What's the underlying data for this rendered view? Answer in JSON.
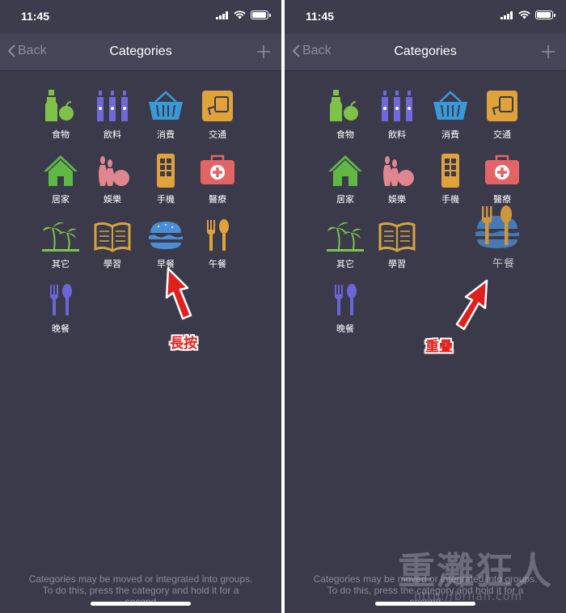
{
  "status": {
    "time": "11:45",
    "battery_level": 0.85
  },
  "navbar": {
    "back_label": "Back",
    "title": "Categories"
  },
  "categories": [
    {
      "label": "食物",
      "icon": "food-icon",
      "color": "#7fc24a"
    },
    {
      "label": "飲料",
      "icon": "drink-icon",
      "color": "#7069d9"
    },
    {
      "label": "消費",
      "icon": "basket-icon",
      "color": "#3a9ad9"
    },
    {
      "label": "交通",
      "icon": "transport-card-icon",
      "color": "#e0a23a"
    },
    {
      "label": "居家",
      "icon": "house-icon",
      "color": "#5fb843"
    },
    {
      "label": "娛樂",
      "icon": "bowling-icon",
      "color": "#e0868f"
    },
    {
      "label": "手機",
      "icon": "phone-icon",
      "color": "#e0a23a"
    },
    {
      "label": "醫療",
      "icon": "medkit-icon",
      "color": "#e46465"
    },
    {
      "label": "其它",
      "icon": "palm-tree-icon",
      "color": "#7fc24a"
    },
    {
      "label": "學習",
      "icon": "book-icon",
      "color": "#d8a43c"
    },
    {
      "label": "早餐",
      "icon": "burger-icon",
      "color": "#4b8ed6"
    },
    {
      "label": "午餐",
      "icon": "fork-spoon-icon",
      "color": "#e0a23a"
    },
    {
      "label": "晚餐",
      "icon": "fork-spoon-icon",
      "color": "#6a66d8"
    }
  ],
  "annotations": {
    "left_note": "長按",
    "right_note": "重疊"
  },
  "dragged_label": "午餐",
  "footer": {
    "line1": "Categories may be moved or integrated into groups.",
    "line2": "To do this, press the category and hold it for a",
    "line3": "second"
  },
  "watermark": {
    "text": "重灘狂人",
    "url": "http://briian.com"
  },
  "colors": {
    "background": "#3b3a4b",
    "navbar": "#464557",
    "annotation": "#e0211b"
  }
}
